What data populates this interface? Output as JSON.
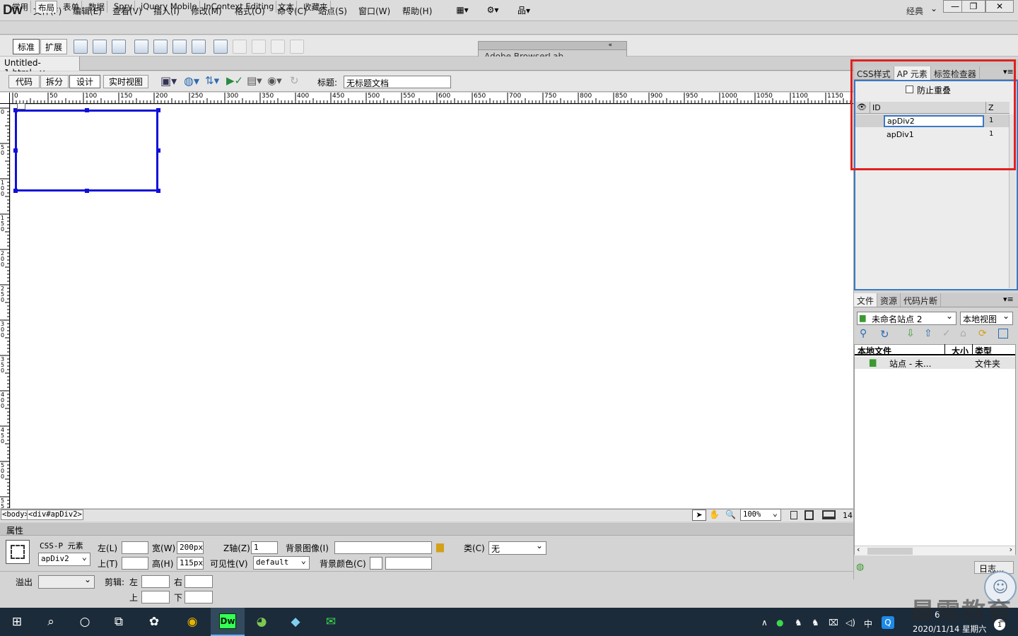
{
  "app": {
    "logo": "Dw"
  },
  "menu": [
    "文件(F)",
    "编辑(E)",
    "查看(V)",
    "插入(I)",
    "修改(M)",
    "格式(O)",
    "命令(C)",
    "站点(S)",
    "窗口(W)",
    "帮助(H)"
  ],
  "workspace": {
    "label": "经典"
  },
  "window_controls": {
    "minimize": "—",
    "restore": "❐",
    "close": "✕"
  },
  "insert_tabs": [
    "常用",
    "布局",
    "表单",
    "数据",
    "Spry",
    "jQuery Mobile",
    "InContext Editing",
    "文本",
    "收藏夹"
  ],
  "insert_panel": {
    "standard": "标准",
    "expanded": "扩展"
  },
  "browserlab": {
    "title": "Adobe BrowserLab"
  },
  "document": {
    "tab": "Untitled-1.html",
    "tab_close": "×",
    "views": [
      "代码",
      "拆分",
      "设计",
      "实时视图"
    ],
    "title_label": "标题:",
    "title_value": "无标题文档"
  },
  "ruler": {
    "h_ticks": [
      "0",
      "50",
      "100",
      "150",
      "200",
      "250",
      "300",
      "350",
      "400",
      "450",
      "500",
      "550",
      "600",
      "650",
      "700",
      "750",
      "800",
      "850",
      "900",
      "950",
      "1000",
      "1050",
      "1100",
      "1150"
    ],
    "v_ticks": [
      "0",
      "50",
      "100",
      "150",
      "200",
      "250",
      "300",
      "350",
      "400",
      "450",
      "500",
      "550"
    ]
  },
  "status": {
    "tag1": "<body>",
    "tag2": "<div#apDiv2>",
    "zoom": "100%",
    "size": "14"
  },
  "properties": {
    "header": "属性",
    "element_type": "CSS-P 元素",
    "element_id": "apDiv2",
    "left_label": "左(L)",
    "left_value": "",
    "top_label": "上(T)",
    "top_value": "",
    "width_label": "宽(W)",
    "width_value": "200px",
    "height_label": "高(H)",
    "height_value": "115px",
    "z_label": "Z轴(Z)",
    "z_value": "1",
    "vis_label": "可见性(V)",
    "vis_value": "default",
    "bgimg_label": "背景图像(I)",
    "bgimg_value": "",
    "bgcolor_label": "背景颜色(C)",
    "bgcolor_value": "",
    "class_label": "类(C)",
    "class_value": "无",
    "overflow_label": "溢出",
    "overflow_value": "",
    "clip_label": "剪辑:",
    "clip_left": "左",
    "clip_right": "右",
    "clip_top": "上",
    "clip_bottom": "下"
  },
  "ap_panel": {
    "tabs": [
      "CSS样式",
      "AP 元素",
      "标签检查器"
    ],
    "prevent_overlap": "防止重叠",
    "col_id": "ID",
    "col_z": "Z",
    "rows": [
      {
        "id": "apDiv2",
        "z": "1"
      },
      {
        "id": "apDiv1",
        "z": "1"
      }
    ]
  },
  "files_panel": {
    "tabs": [
      "文件",
      "资源",
      "代码片断"
    ],
    "site": "未命名站点 2",
    "view": "本地视图",
    "col_local": "本地文件",
    "col_size": "大小",
    "col_type": "类型",
    "rows": [
      {
        "name": "站点 - 未...",
        "type": "文件夹"
      }
    ],
    "log": "日志..."
  },
  "taskbar": {
    "dw": "Dw",
    "ime": "中",
    "time": "6",
    "date": "2020/11/14 星期六",
    "notif": "1"
  },
  "watermark": "最需教育",
  "colors": {
    "selection": "#1010d8",
    "highlight": "#e02020"
  }
}
